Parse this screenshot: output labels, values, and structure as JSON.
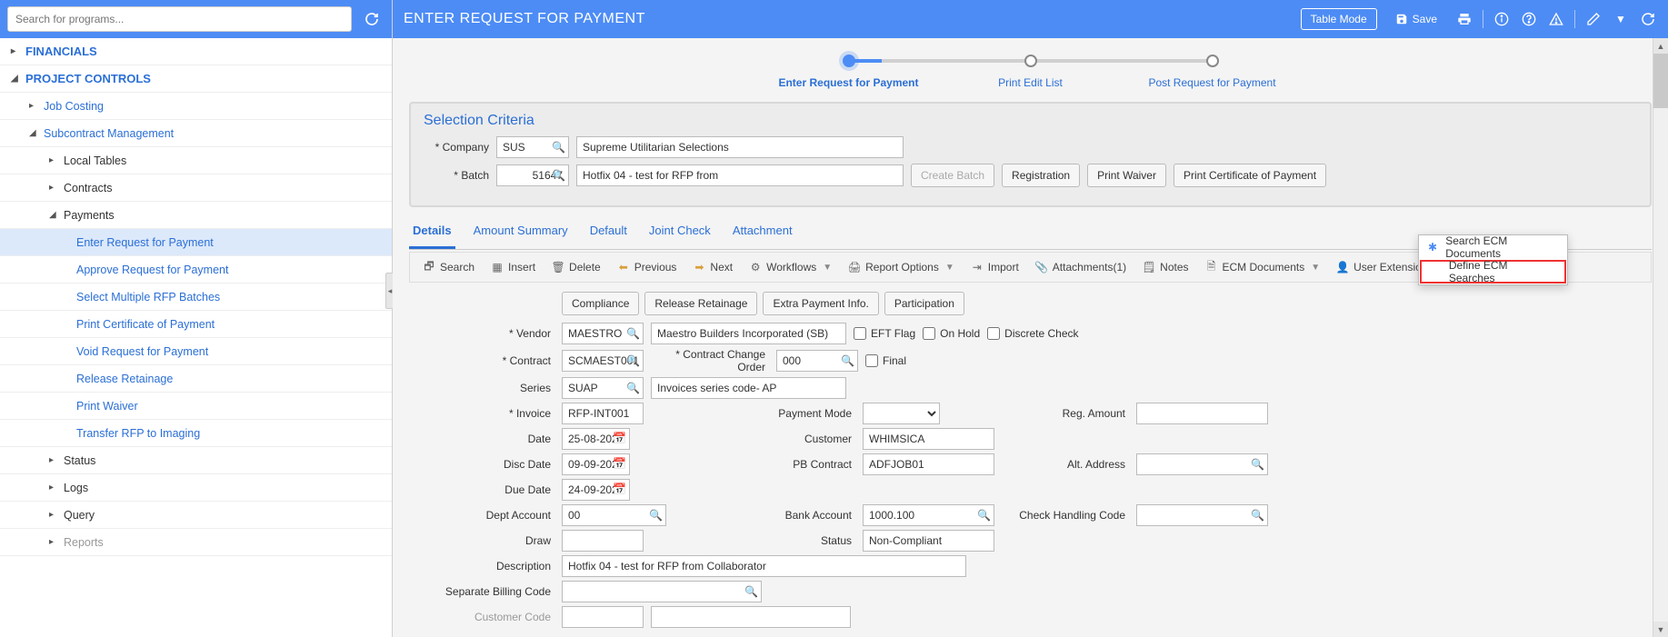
{
  "sidebar": {
    "search_placeholder": "Search for programs...",
    "items": [
      {
        "label": "FINANCIALS",
        "level": 1,
        "arrow": "▸"
      },
      {
        "label": "PROJECT CONTROLS",
        "level": 1,
        "arrow": "◢"
      },
      {
        "label": "Job Costing",
        "level": 2,
        "arrow": "▸"
      },
      {
        "label": "Subcontract Management",
        "level": 2,
        "arrow": "◢"
      },
      {
        "label": "Local Tables",
        "level": 3,
        "arrow": "▸"
      },
      {
        "label": "Contracts",
        "level": 3,
        "arrow": "▸"
      },
      {
        "label": "Payments",
        "level": 3,
        "arrow": "◢"
      },
      {
        "label": "Enter Request for Payment",
        "level": 5,
        "selected": true
      },
      {
        "label": "Approve Request for Payment",
        "level": 5
      },
      {
        "label": "Select Multiple RFP Batches",
        "level": 5
      },
      {
        "label": "Print Certificate of Payment",
        "level": 5
      },
      {
        "label": "Void Request for Payment",
        "level": 5
      },
      {
        "label": "Release Retainage",
        "level": 5
      },
      {
        "label": "Print Waiver",
        "level": 5
      },
      {
        "label": "Transfer RFP to Imaging",
        "level": 5
      },
      {
        "label": "Status",
        "level": 3,
        "arrow": "▸"
      },
      {
        "label": "Logs",
        "level": 3,
        "arrow": "▸"
      },
      {
        "label": "Query",
        "level": 3,
        "arrow": "▸"
      },
      {
        "label": "Reports",
        "level": 3,
        "arrow": "▸",
        "dim": true
      }
    ]
  },
  "titlebar": {
    "title": "ENTER REQUEST FOR PAYMENT",
    "table_mode": "Table Mode",
    "save": "Save"
  },
  "stepper": {
    "s1": "Enter Request for Payment",
    "s2": "Print Edit List",
    "s3": "Post Request for Payment"
  },
  "criteria": {
    "title": "Selection Criteria",
    "company_lbl": "Company",
    "company_val": "SUS",
    "company_desc": "Supreme Utilitarian Selections",
    "batch_lbl": "Batch",
    "batch_val": "51647",
    "batch_desc": "Hotfix 04 - test for RFP from",
    "create_batch": "Create Batch",
    "registration": "Registration",
    "print_waiver": "Print Waiver",
    "print_cert": "Print Certificate of Payment"
  },
  "tabs": {
    "t1": "Details",
    "t2": "Amount Summary",
    "t3": "Default",
    "t4": "Joint Check",
    "t5": "Attachment"
  },
  "toolbar": {
    "search": "Search",
    "insert": "Insert",
    "delete": "Delete",
    "previous": "Previous",
    "next": "Next",
    "workflows": "Workflows",
    "report_options": "Report Options",
    "import": "Import",
    "attachments": "Attachments(1)",
    "notes": "Notes",
    "ecm_documents": "ECM Documents",
    "user_extensions": "User Extensions"
  },
  "sub_buttons": {
    "compliance": "Compliance",
    "release_retainage": "Release Retainage",
    "extra_payment": "Extra Payment Info.",
    "participation": "Participation"
  },
  "details": {
    "vendor_lbl": "Vendor",
    "vendor_val": "MAESTRO",
    "vendor_desc": "Maestro Builders Incorporated (SB)",
    "eft_flag": "EFT Flag",
    "on_hold": "On Hold",
    "discrete": "Discrete Check",
    "contract_lbl": "Contract",
    "contract_val": "SCMAEST001",
    "cco_lbl": "Contract Change Order",
    "cco_val": "000",
    "final": "Final",
    "series_lbl": "Series",
    "series_val": "SUAP",
    "series_desc": "Invoices series code- AP",
    "invoice_lbl": "Invoice",
    "invoice_val": "RFP-INT001",
    "payment_mode_lbl": "Payment Mode",
    "reg_amount_lbl": "Reg. Amount",
    "date_lbl": "Date",
    "date_val": "25-08-2022",
    "customer_lbl": "Customer",
    "customer_val": "WHIMSICA",
    "disc_date_lbl": "Disc Date",
    "disc_date_val": "09-09-2022",
    "pb_contract_lbl": "PB Contract",
    "pb_contract_val": "ADFJOB01",
    "alt_addr_lbl": "Alt. Address",
    "due_date_lbl": "Due Date",
    "due_date_val": "24-09-2022",
    "dept_acct_lbl": "Dept Account",
    "dept_acct_val": "00",
    "bank_acct_lbl": "Bank Account",
    "bank_acct_val": "1000.100",
    "chk_handling_lbl": "Check Handling Code",
    "draw_lbl": "Draw",
    "status_lbl": "Status",
    "status_val": "Non-Compliant",
    "desc_lbl": "Description",
    "desc_val": "Hotfix 04 - test for RFP from Collaborator",
    "sbc_lbl": "Separate Billing Code",
    "cust_code_lbl": "Customer Code"
  },
  "ecm_menu": {
    "search": "Search ECM Documents",
    "define": "Define ECM Searches"
  }
}
